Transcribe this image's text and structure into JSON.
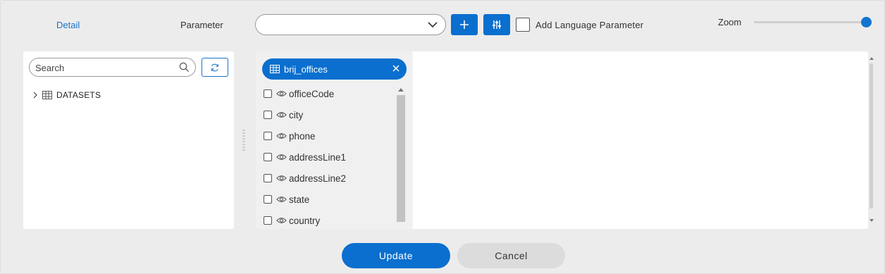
{
  "header": {
    "detail_tab": "Detail",
    "parameter_label": "Parameter",
    "parameter_value": "",
    "add_language_label": "Add Language Parameter",
    "zoom_label": "Zoom",
    "zoom_level": 1.0
  },
  "sidebar": {
    "search_placeholder": "Search",
    "tree_root": "DATASETS"
  },
  "table": {
    "name": "brij_offices",
    "columns": [
      {
        "name": "officeCode"
      },
      {
        "name": "city"
      },
      {
        "name": "phone"
      },
      {
        "name": "addressLine1"
      },
      {
        "name": "addressLine2"
      },
      {
        "name": "state"
      },
      {
        "name": "country"
      }
    ]
  },
  "footer": {
    "update_label": "Update",
    "cancel_label": "Cancel"
  },
  "colors": {
    "accent": "#0a6fce",
    "link": "#1a73c8",
    "background": "#ececec"
  },
  "icons": [
    "chevron-down-icon",
    "plus-icon",
    "sliders-icon",
    "search-icon",
    "refresh-icon",
    "chevron-right-icon",
    "table-icon",
    "close-icon",
    "eye-icon"
  ]
}
